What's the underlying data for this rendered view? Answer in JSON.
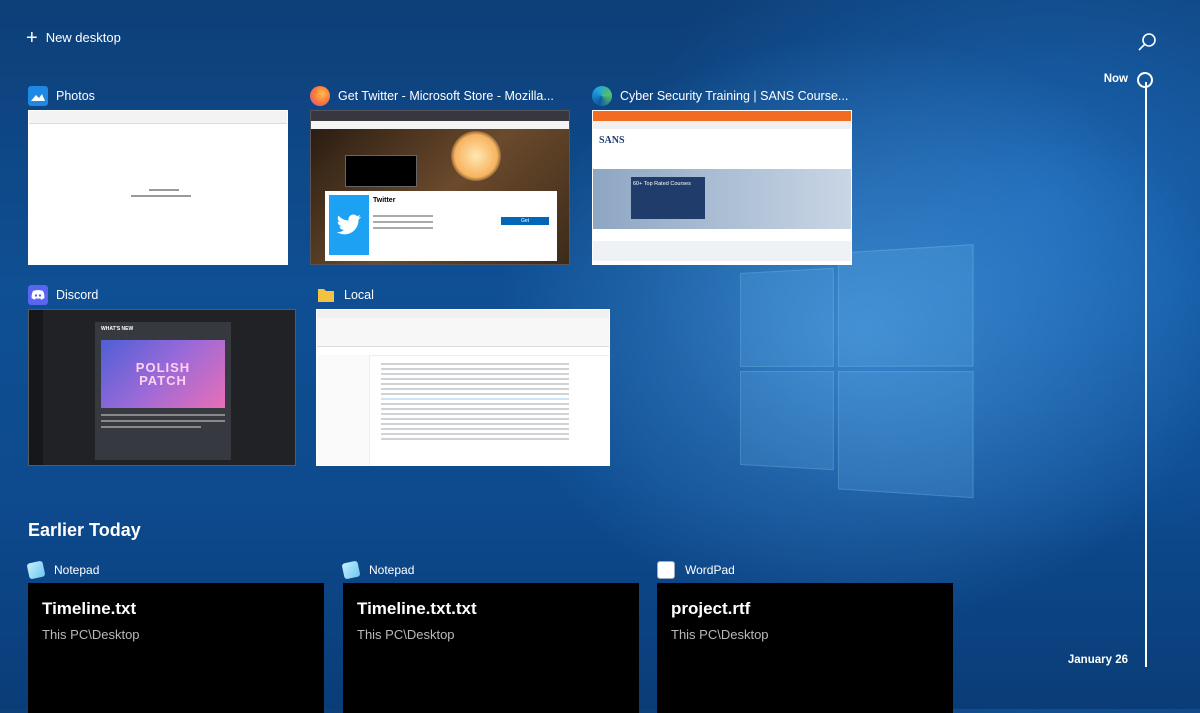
{
  "topbar": {
    "new_desktop_label": "New desktop"
  },
  "windows": [
    {
      "title": "Photos",
      "icon": "photos-icon",
      "color": "#1e88e5"
    },
    {
      "title": "Get Twitter - Microsoft Store - Mozilla...",
      "icon": "firefox-icon",
      "color": "#ff7139"
    },
    {
      "title": "Cyber Security Training | SANS Course...",
      "icon": "edge-icon",
      "color": "#1fa2e0"
    },
    {
      "title": "Discord",
      "icon": "discord-icon",
      "color": "#5865f2"
    },
    {
      "title": "Local",
      "icon": "folder-icon",
      "color": "#f3c242"
    }
  ],
  "thumbs": {
    "twitter": {
      "app_name": "Twitter",
      "button": "Get"
    },
    "sans": {
      "brand": "SANS",
      "banner": "60+ Top Rated Courses"
    },
    "discord": {
      "heading": "WHAT'S NEW",
      "art": "POLISH PATCH"
    }
  },
  "earlier": {
    "title": "Earlier Today",
    "activities": [
      {
        "app": "Notepad",
        "icon": "notepad-icon",
        "file": "Timeline.txt",
        "path": "This PC\\Desktop"
      },
      {
        "app": "Notepad",
        "icon": "notepad-icon",
        "file": "Timeline.txt.txt",
        "path": "This PC\\Desktop"
      },
      {
        "app": "WordPad",
        "icon": "wordpad-icon",
        "file": "project.rtf",
        "path": "This PC\\Desktop"
      }
    ]
  },
  "timeline": {
    "now_label": "Now",
    "date_label": "January 26"
  }
}
